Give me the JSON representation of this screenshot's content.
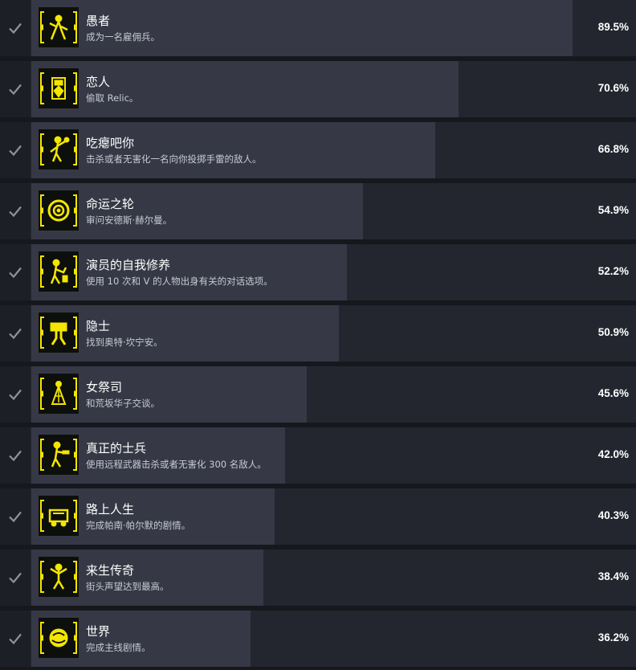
{
  "colors": {
    "accent_yellow": "#f3e600",
    "row_bg": "#23262f",
    "bar_fill": "#363945",
    "check_gray": "#8e939b"
  },
  "achievements": [
    {
      "title": "愚者",
      "description": "成为一名雇佣兵。",
      "percent_label": "89.5%",
      "percent": 89.5,
      "icon": "fool-tarot-icon",
      "check_icon": "checkmark-icon"
    },
    {
      "title": "恋人",
      "description": "偷取 Relic。",
      "percent_label": "70.6%",
      "percent": 70.6,
      "icon": "lovers-tarot-icon",
      "check_icon": "checkmark-icon"
    },
    {
      "title": "吃瘪吧你",
      "description": "击杀或者无害化一名向你投掷手雷的敌人。",
      "percent_label": "66.8%",
      "percent": 66.8,
      "icon": "grenade-thrower-icon",
      "check_icon": "checkmark-icon"
    },
    {
      "title": "命运之轮",
      "description": "审问安德斯·赫尔曼。",
      "percent_label": "54.9%",
      "percent": 54.9,
      "icon": "wheel-of-fortune-icon",
      "check_icon": "checkmark-icon"
    },
    {
      "title": "演员的自我修养",
      "description": "使用 10 次和 V 的人物出身有关的对话选项。",
      "percent_label": "52.2%",
      "percent": 52.2,
      "icon": "actor-icon",
      "check_icon": "checkmark-icon"
    },
    {
      "title": "隐士",
      "description": "找到奥特·坎宁安。",
      "percent_label": "50.9%",
      "percent": 50.9,
      "icon": "hermit-tarot-icon",
      "check_icon": "checkmark-icon"
    },
    {
      "title": "女祭司",
      "description": "和荒坂华子交谈。",
      "percent_label": "45.6%",
      "percent": 45.6,
      "icon": "priestess-tarot-icon",
      "check_icon": "checkmark-icon"
    },
    {
      "title": "真正的士兵",
      "description": "使用远程武器击杀或者无害化 300 名敌人。",
      "percent_label": "42.0%",
      "percent": 42.0,
      "icon": "soldier-icon",
      "check_icon": "checkmark-icon"
    },
    {
      "title": "路上人生",
      "description": "完成帕南·帕尔默的剧情。",
      "percent_label": "40.3%",
      "percent": 40.3,
      "icon": "road-life-icon",
      "check_icon": "checkmark-icon"
    },
    {
      "title": "来生传奇",
      "description": "街头声望达到最高。",
      "percent_label": "38.4%",
      "percent": 38.4,
      "icon": "afterlife-legend-icon",
      "check_icon": "checkmark-icon"
    },
    {
      "title": "世界",
      "description": "完成主线剧情。",
      "percent_label": "36.2%",
      "percent": 36.2,
      "icon": "world-tarot-icon",
      "check_icon": "checkmark-icon"
    }
  ]
}
